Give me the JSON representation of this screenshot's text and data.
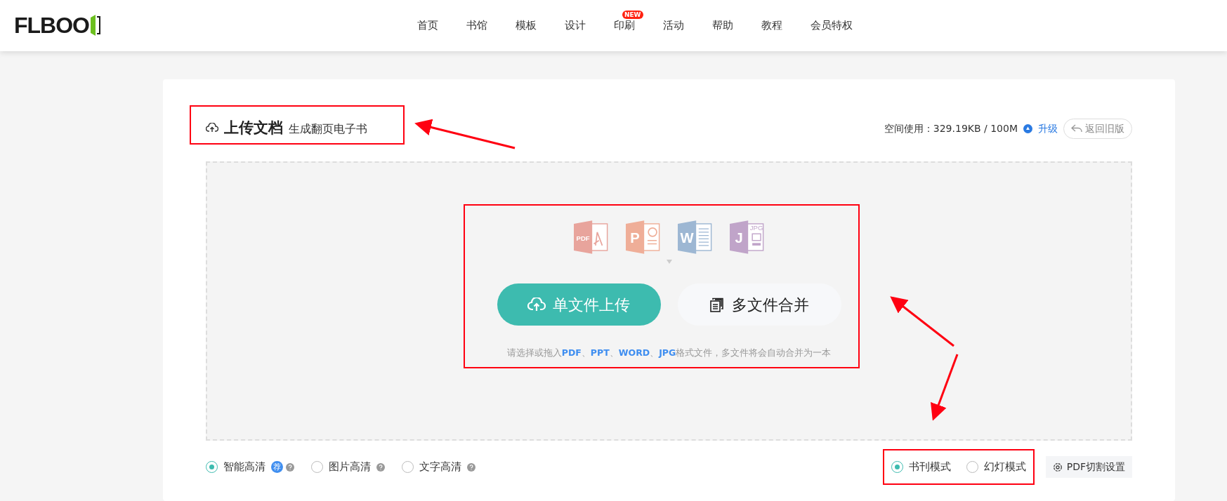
{
  "header": {
    "logo": "FLBOO",
    "nav": [
      {
        "label": "首页"
      },
      {
        "label": "书馆"
      },
      {
        "label": "模板"
      },
      {
        "label": "设计"
      },
      {
        "label": "印刷",
        "badge": "NEW"
      },
      {
        "label": "活动"
      },
      {
        "label": "帮助"
      },
      {
        "label": "教程"
      },
      {
        "label": "会员特权"
      }
    ]
  },
  "upload": {
    "title": "上传文档",
    "subtitle": "生成翻页电子书",
    "usage": "空间使用：329.19KB / 100M",
    "upgrade": "升级",
    "back_button": "返回旧版",
    "file_icons": [
      {
        "kind": "pdf",
        "letter": "PDF",
        "color": "#e8a49c"
      },
      {
        "kind": "ppt",
        "letter": "P",
        "color": "#efae98"
      },
      {
        "kind": "word",
        "letter": "W",
        "color": "#9db7d3"
      },
      {
        "kind": "jpg",
        "letter": "J",
        "sub": "JPG",
        "color": "#c0a4c9"
      }
    ],
    "single_button": "单文件上传",
    "multi_button": "多文件合并",
    "hint": "请选择或拖入**PDF**、**PPT**、**WORD**、**JPG**格式文件，多文件将会自动合并为一本"
  },
  "quality_options": [
    {
      "label": "智能高清",
      "selected": true,
      "badge": "荐"
    },
    {
      "label": "图片高清",
      "selected": false
    },
    {
      "label": "文字高清",
      "selected": false
    }
  ],
  "mode_options": [
    {
      "label": "书刊模式",
      "selected": true
    },
    {
      "label": "幻灯模式",
      "selected": false
    }
  ],
  "pdf_split_button": "PDF切割设置"
}
